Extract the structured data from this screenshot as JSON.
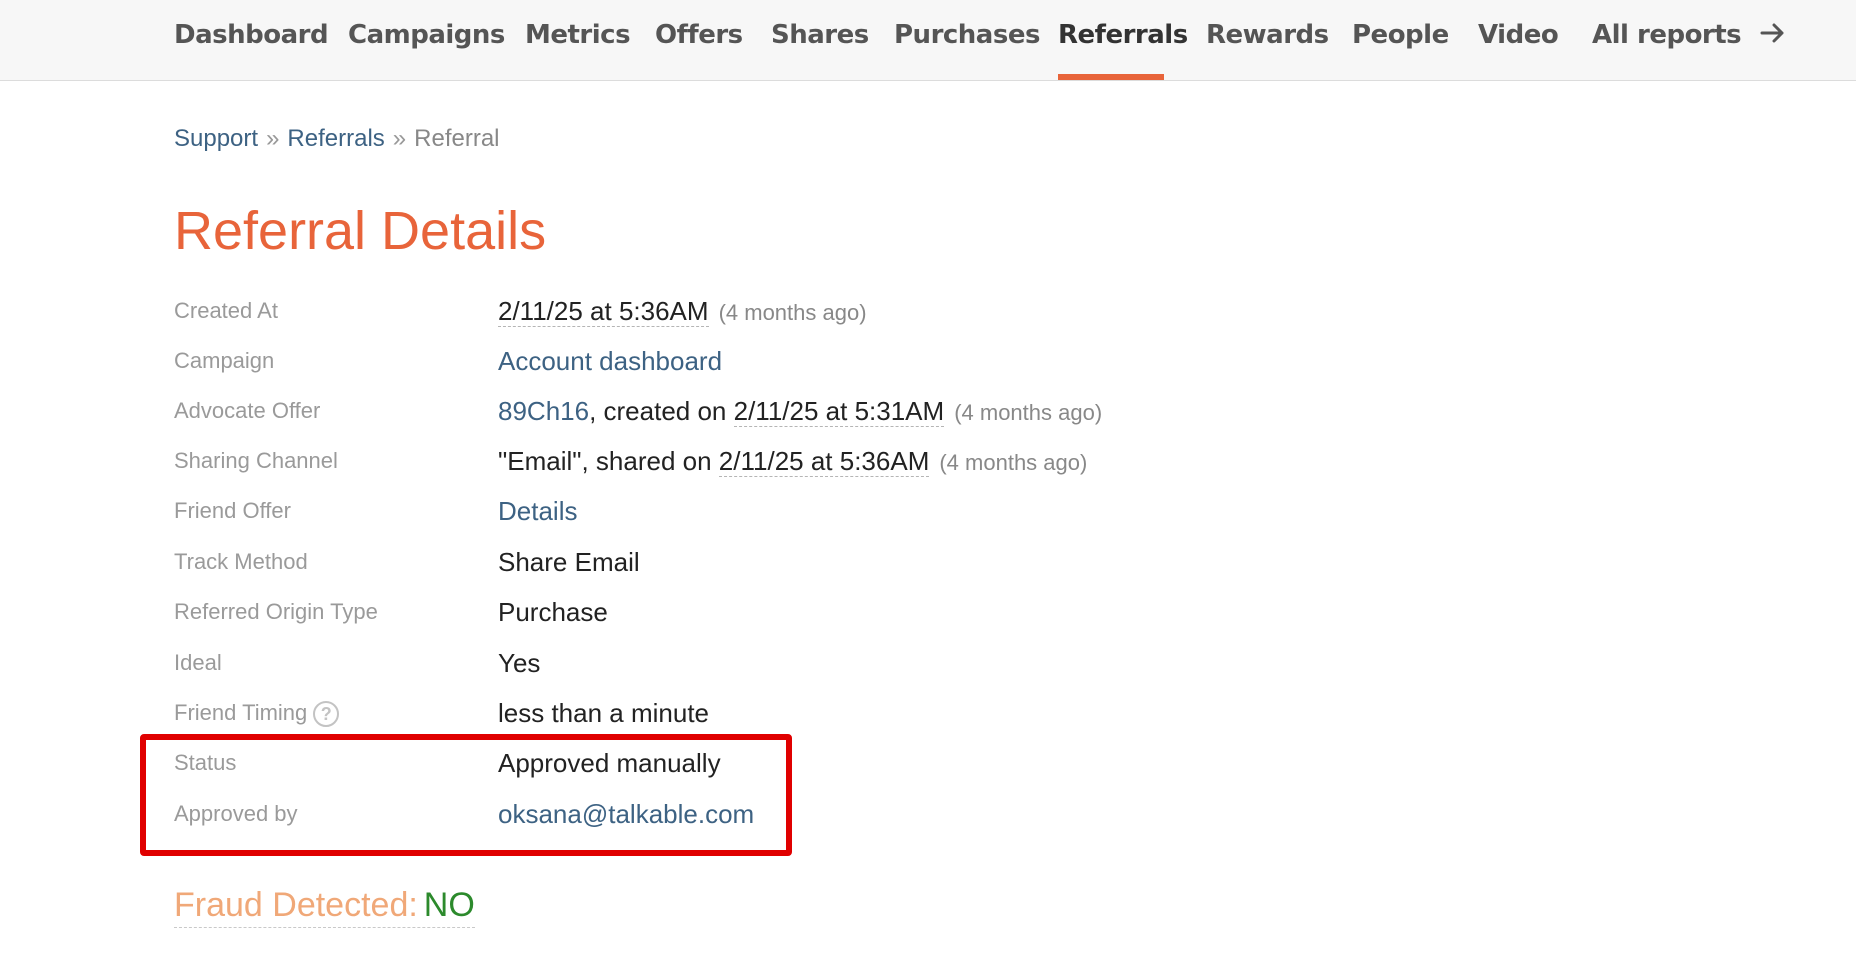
{
  "nav": {
    "items": [
      {
        "label": "Dashboard"
      },
      {
        "label": "Campaigns"
      },
      {
        "label": "Metrics"
      },
      {
        "label": "Offers"
      },
      {
        "label": "Shares"
      },
      {
        "label": "Purchases"
      },
      {
        "label": "Referrals",
        "active": true
      },
      {
        "label": "Rewards"
      },
      {
        "label": "People"
      },
      {
        "label": "Video"
      },
      {
        "label": "All reports"
      }
    ],
    "accent_color": "#e8643a",
    "all_reports_icon": "arrow-right-icon"
  },
  "breadcrumb": {
    "items": [
      "Support",
      "Referrals",
      "Referral"
    ],
    "separator": "»"
  },
  "title": "Referral Details",
  "details": {
    "created_at": {
      "label": "Created At",
      "value": "2/11/25 at 5:36AM",
      "ago": "(4 months ago)"
    },
    "campaign": {
      "label": "Campaign",
      "value": "Account dashboard"
    },
    "advocate_offer": {
      "label": "Advocate Offer",
      "link": "89Ch16",
      "text": ", created on ",
      "date": "2/11/25 at 5:31AM",
      "ago": "(4 months ago)"
    },
    "sharing_channel": {
      "label": "Sharing Channel",
      "text": "\"Email\", shared on ",
      "date": "2/11/25 at 5:36AM",
      "ago": "(4 months ago)"
    },
    "friend_offer": {
      "label": "Friend Offer",
      "value": "Details"
    },
    "track_method": {
      "label": "Track Method",
      "value": "Share Email"
    },
    "referred_origin_type": {
      "label": "Referred Origin Type",
      "value": "Purchase"
    },
    "ideal": {
      "label": "Ideal",
      "value": "Yes"
    },
    "friend_timing": {
      "label": "Friend Timing",
      "value": "less than a minute",
      "help_icon": "?"
    },
    "status": {
      "label": "Status",
      "value": "Approved manually"
    },
    "approved_by": {
      "label": "Approved by",
      "value": "oksana@talkable.com"
    }
  },
  "fraud": {
    "label": "Fraud Detected:",
    "value": "NO",
    "value_color": "#2c8a2c"
  },
  "highlight_color": "#e00000"
}
